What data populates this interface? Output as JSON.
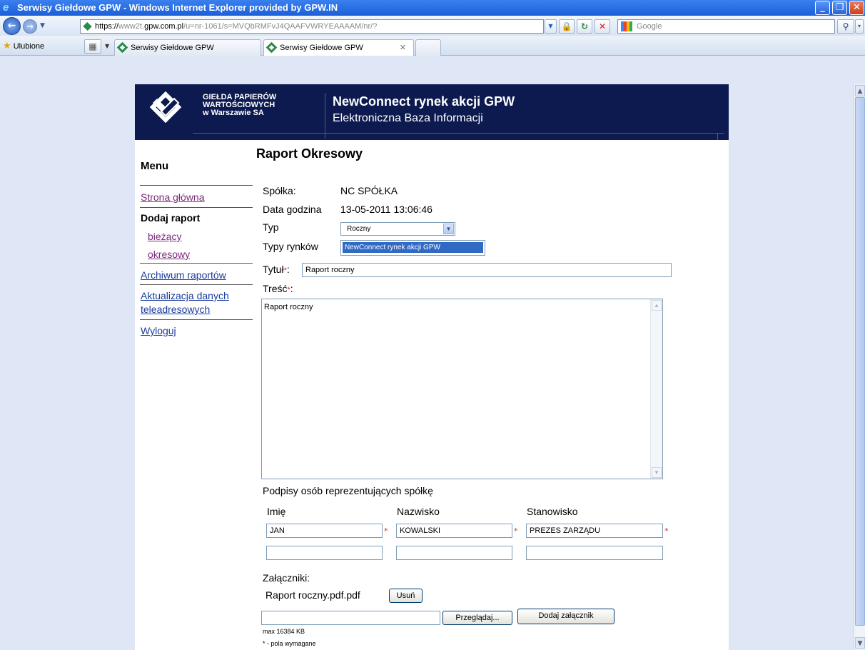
{
  "window": {
    "title": "Serwisy Giełdowe GPW - Windows Internet Explorer provided by GPW.IN",
    "minimize": "_",
    "restore": "❐",
    "close": "✕"
  },
  "address": {
    "prefix": "https://",
    "host_light": "www2t.",
    "host": "gpw.com.pl",
    "path": "/u=nr-1061/s=MVQbRMFvJ4QAAFVWRYEAAAAM/nr/?"
  },
  "search": {
    "placeholder": "Google"
  },
  "favorites": {
    "label": "Ulubione"
  },
  "tabs": [
    {
      "label": "Serwisy Giełdowe GPW"
    },
    {
      "label": "Serwisy Giełdowe GPW",
      "close": "✕"
    }
  ],
  "header": {
    "gpw_line1": "GIEŁDA PAPIERÓW",
    "gpw_line2": "WARTOŚCIOWYCH",
    "gpw_line3": "w Warszawie SA",
    "title": "NewConnect rynek akcji GPW",
    "subtitle": "Elektroniczna Baza Informacji"
  },
  "menu": {
    "heading": "Menu",
    "home": "Strona główna",
    "add_report": "Dodaj raport",
    "current": "bieżący",
    "periodic": "okresowy",
    "archive": "Archiwum raportów",
    "update_line1": "Aktualizacja danych",
    "update_line2": "teleadresowych",
    "logout": "Wyloguj"
  },
  "form": {
    "heading": "Raport Okresowy",
    "company_label": "Spółka:",
    "company_value": "NC SPÓŁKA",
    "datetime_label": "Data godzina",
    "datetime_value": "13-05-2011 13:06:46",
    "type_label": "Typ",
    "type_value": "Roczny",
    "markets_label": "Typy rynków",
    "markets_selected": "NewConnect rynek akcji GPW",
    "title_label": "Tytuł",
    "title_value": "Raport roczny",
    "content_label": "Treść",
    "content_value": "Raport roczny",
    "required_mark": "*",
    "signatures_label": "Podpisy osób reprezentujących spółkę",
    "col_first": "Imię",
    "col_last": "Nazwisko",
    "col_position": "Stanowisko",
    "sig1_first": "JAN",
    "sig1_last": "KOWALSKI",
    "sig1_position": "PREZES ZARZĄDU",
    "attachments_label": "Załączniki:",
    "attachment_name": "Raport roczny.pdf.pdf",
    "remove_button": "Usuń",
    "browse_button": "Przeglądaj...",
    "add_attachment_button": "Dodaj załącznik",
    "max_size": "max 16384 KB",
    "required_note": "* - pola wymagane"
  }
}
